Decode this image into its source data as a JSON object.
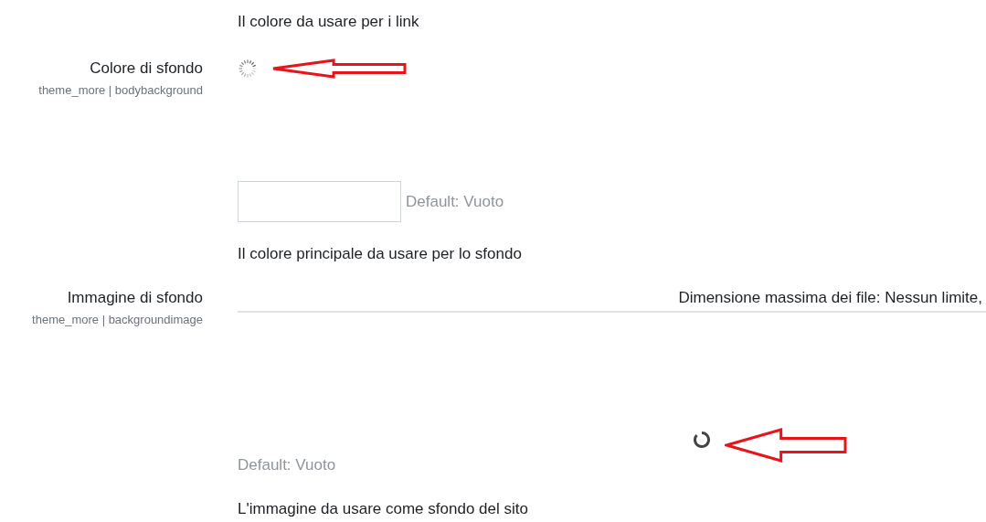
{
  "intro_description": "Il colore da usare per i link",
  "settings": [
    {
      "kind": "color",
      "label": "Colore di sfondo",
      "setting_id": "theme_more | bodybackground",
      "loading": true,
      "default": "Default: Vuoto",
      "description": "Il colore principale da usare per lo sfondo"
    },
    {
      "kind": "file",
      "label": "Immagine di sfondo",
      "setting_id": "theme_more | backgroundimage",
      "loading": true,
      "max_size": "Dimensione massima dei file: Nessun limite,",
      "default": "Default: Vuoto",
      "description": "L'immagine da usare come sfondo del sito"
    }
  ]
}
